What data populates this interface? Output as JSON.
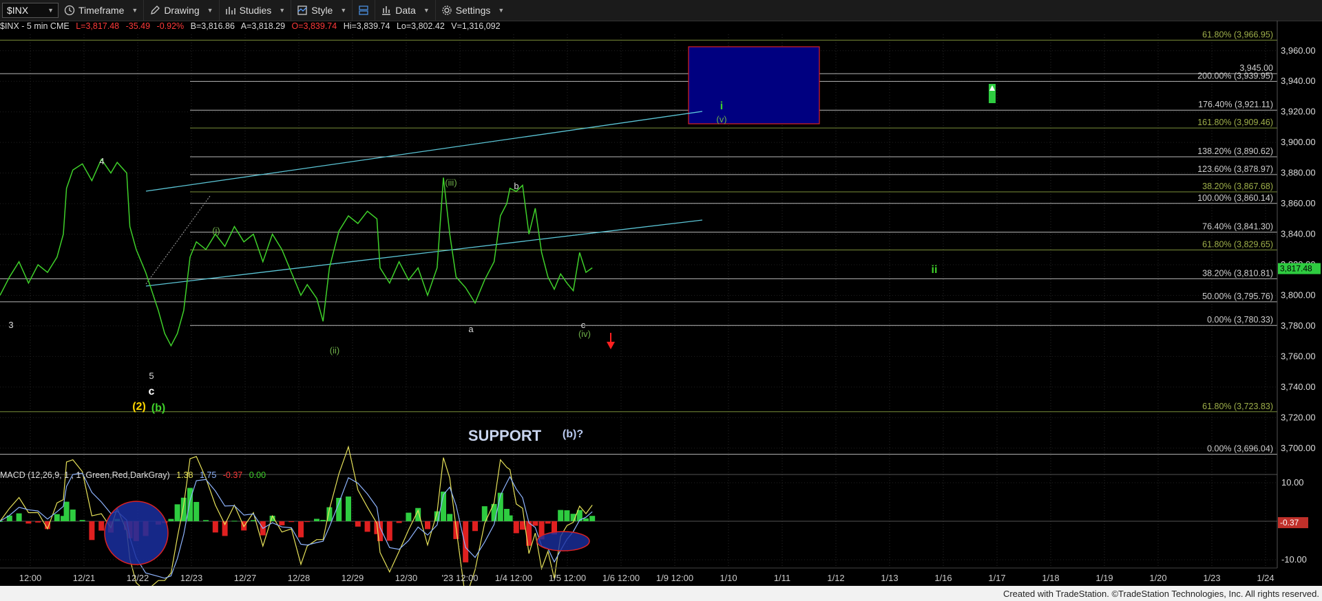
{
  "toolbar": {
    "symbol": "$INX",
    "items": [
      {
        "label": "Timeframe",
        "icon": "clock-icon"
      },
      {
        "label": "Drawing",
        "icon": "pencil-icon"
      },
      {
        "label": "Studies",
        "icon": "studies-icon"
      },
      {
        "label": "Style",
        "icon": "style-icon"
      },
      {
        "label": "",
        "icon": "layout-icon"
      },
      {
        "label": "Data",
        "icon": "bar-chart-icon"
      },
      {
        "label": "Settings",
        "icon": "gear-icon"
      }
    ]
  },
  "infobar": {
    "symbol": "$INX - 5 min  CME",
    "last": "L=3,817.48",
    "change": "-35.49",
    "pct": "-0.92%",
    "bid": "B=3,816.86",
    "ask": "A=3,818.29",
    "open": "O=3,839.74",
    "high": "Hi=3,839.74",
    "low": "Lo=3,802.42",
    "volume": "V=1,316,092"
  },
  "colors": {
    "price": "#3fd12a",
    "up": "#ff3030",
    "fib_line": "#c8c8c8",
    "green_line": "#6f8a3c",
    "blue_box": "#000080",
    "macd_line": "#e8e35a",
    "signal_line": "#8fb5ff"
  },
  "chart_data": {
    "type": "line",
    "title": "$INX - 5 min",
    "x_ticks": [
      "12:00",
      "12/21",
      "12/22",
      "12/23",
      "12/27",
      "12/28",
      "12/29",
      "12/30",
      "'23 12:00",
      "1/4 12:00",
      "1/5 12:00",
      "1/6 12:00",
      "1/9 12:00",
      "1/10",
      "1/11",
      "1/12",
      "1/13",
      "1/16",
      "1/17",
      "1/18",
      "1/19",
      "1/20",
      "1/23",
      "1/24"
    ],
    "y_ticks": [
      3700,
      3720,
      3740,
      3760,
      3780,
      3800,
      3820,
      3840,
      3860,
      3880,
      3900,
      3920,
      3940,
      3960
    ],
    "ylim": [
      3690,
      3968
    ],
    "last_price_label": "3,817.48",
    "price_series": [
      [
        0,
        3800
      ],
      [
        0.15,
        3812
      ],
      [
        0.3,
        3822
      ],
      [
        0.45,
        3808
      ],
      [
        0.6,
        3820
      ],
      [
        0.75,
        3815
      ],
      [
        0.9,
        3825
      ],
      [
        1.0,
        3840
      ],
      [
        1.05,
        3870
      ],
      [
        1.15,
        3882
      ],
      [
        1.3,
        3886
      ],
      [
        1.45,
        3875
      ],
      [
        1.6,
        3889
      ],
      [
        1.75,
        3880
      ],
      [
        1.85,
        3887
      ],
      [
        2.0,
        3880
      ],
      [
        2.05,
        3845
      ],
      [
        2.15,
        3830
      ],
      [
        2.3,
        3815
      ],
      [
        2.5,
        3790
      ],
      [
        2.6,
        3775
      ],
      [
        2.7,
        3767
      ],
      [
        2.8,
        3775
      ],
      [
        2.9,
        3790
      ],
      [
        3.0,
        3825
      ],
      [
        3.1,
        3835
      ],
      [
        3.25,
        3830
      ],
      [
        3.4,
        3840
      ],
      [
        3.55,
        3832
      ],
      [
        3.7,
        3845
      ],
      [
        3.85,
        3835
      ],
      [
        4.0,
        3840
      ],
      [
        4.15,
        3822
      ],
      [
        4.3,
        3840
      ],
      [
        4.45,
        3830
      ],
      [
        4.6,
        3815
      ],
      [
        4.75,
        3800
      ],
      [
        4.85,
        3807
      ],
      [
        5.0,
        3798
      ],
      [
        5.1,
        3783
      ],
      [
        5.2,
        3818
      ],
      [
        5.35,
        3842
      ],
      [
        5.5,
        3852
      ],
      [
        5.65,
        3847
      ],
      [
        5.8,
        3855
      ],
      [
        5.95,
        3850
      ],
      [
        6.0,
        3818
      ],
      [
        6.15,
        3808
      ],
      [
        6.3,
        3822
      ],
      [
        6.45,
        3810
      ],
      [
        6.6,
        3818
      ],
      [
        6.75,
        3800
      ],
      [
        6.9,
        3818
      ],
      [
        7.0,
        3877
      ],
      [
        7.1,
        3840
      ],
      [
        7.2,
        3812
      ],
      [
        7.35,
        3805
      ],
      [
        7.5,
        3795
      ],
      [
        7.65,
        3810
      ],
      [
        7.8,
        3822
      ],
      [
        7.9,
        3852
      ],
      [
        8.0,
        3860
      ],
      [
        8.05,
        3870
      ],
      [
        8.15,
        3868
      ],
      [
        8.25,
        3872
      ],
      [
        8.35,
        3840
      ],
      [
        8.45,
        3857
      ],
      [
        8.55,
        3828
      ],
      [
        8.65,
        3812
      ],
      [
        8.75,
        3804
      ],
      [
        8.85,
        3814
      ],
      [
        8.95,
        3808
      ],
      [
        9.05,
        3803
      ],
      [
        9.15,
        3828
      ],
      [
        9.25,
        3815
      ],
      [
        9.35,
        3818
      ]
    ],
    "fib_levels": [
      {
        "label": "61.80% (3,966.95)",
        "value": 3966.95
      },
      {
        "label": "3,945.00",
        "value": 3945.0
      },
      {
        "label": "200.00% (3,939.95)",
        "value": 3939.95
      },
      {
        "label": "176.40% (3,921.11)",
        "value": 3921.11
      },
      {
        "label": "161.80% (3,909.46)",
        "value": 3909.46
      },
      {
        "label": "138.20% (3,890.62)",
        "value": 3890.62
      },
      {
        "label": "123.60% (3,878.97)",
        "value": 3878.97
      },
      {
        "label": "38.20% (3,867.68)",
        "value": 3867.68
      },
      {
        "label": "100.00% (3,860.14)",
        "value": 3860.14
      },
      {
        "label": "76.40% (3,841.30)",
        "value": 3841.3
      },
      {
        "label": "61.80% (3,829.65)",
        "value": 3829.65
      },
      {
        "label": "38.20% (3,810.81)",
        "value": 3810.81
      },
      {
        "label": "50.00% (3,795.76)",
        "value": 3795.76
      },
      {
        "label": "0.00% (3,780.33)",
        "value": 3780.33
      },
      {
        "label": "61.80% (3,723.83)",
        "value": 3723.83
      },
      {
        "label": "0.00% (3,696.04)",
        "value": 3696.04
      }
    ],
    "wave_labels": [
      "3",
      "4",
      "5",
      "c",
      "(2)",
      "(b)",
      "(i)",
      "(ii)",
      "(iii)",
      "a",
      "b",
      "c",
      "(iv)",
      "i",
      "(v)",
      "ii",
      "SUPPORT",
      "(b)?"
    ],
    "macd": {
      "label": "MACD (12,26,9, 1 , 1 ,Green,Red,DarkGray)",
      "macd_value": "1.38",
      "signal_value": "1.75",
      "hist_value": "-0.37",
      "zero_value": "0.00",
      "y_ticks": [
        "10.00",
        "-10.00"
      ],
      "last_label": "-0.37"
    }
  },
  "footer": "Created with TradeStation. ©TradeStation Technologies, Inc. All rights reserved."
}
